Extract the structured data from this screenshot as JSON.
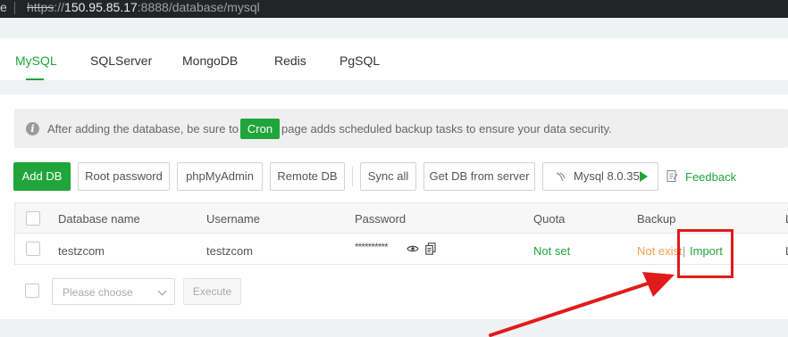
{
  "browser": {
    "edge_char": "e",
    "url_proto": "https",
    "url_slashes": "://",
    "url_host": "150.95.85.17",
    "url_rest": ":8888/database/mysql"
  },
  "tabs": [
    {
      "label": "MySQL",
      "active": true
    },
    {
      "label": "SQLServer",
      "active": false
    },
    {
      "label": "MongoDB",
      "active": false
    },
    {
      "label": "Redis",
      "active": false
    },
    {
      "label": "PgSQL",
      "active": false
    }
  ],
  "alert": {
    "icon": "info-icon",
    "text_before": "After adding the database, be sure to",
    "badge": "Cron",
    "text_after": "page adds scheduled backup tasks to ensure your data security."
  },
  "toolbar": {
    "add_db": "Add DB",
    "root_password": "Root password",
    "phpmyadmin": "phpMyAdmin",
    "remote_db": "Remote DB",
    "sync_all": "Sync all",
    "get_db": "Get DB from server",
    "mysql_version": "Mysql 8.0.35",
    "feedback": "Feedback"
  },
  "table": {
    "headers": {
      "name": "Database name",
      "username": "Username",
      "password": "Password",
      "quota": "Quota",
      "backup": "Backup",
      "extra": "L"
    },
    "rows": [
      {
        "name": "testzcom",
        "username": "testzcom",
        "password_masked": "**********",
        "quota": "Not set",
        "backup_status": "Not exist",
        "backup_sep": "|",
        "backup_action": "Import",
        "extra": "L"
      }
    ]
  },
  "batch": {
    "placeholder": "Please choose",
    "execute": "Execute"
  },
  "colors": {
    "accent": "#20a53a",
    "warning": "#f0a04b",
    "annotation": "#e01b1b"
  }
}
